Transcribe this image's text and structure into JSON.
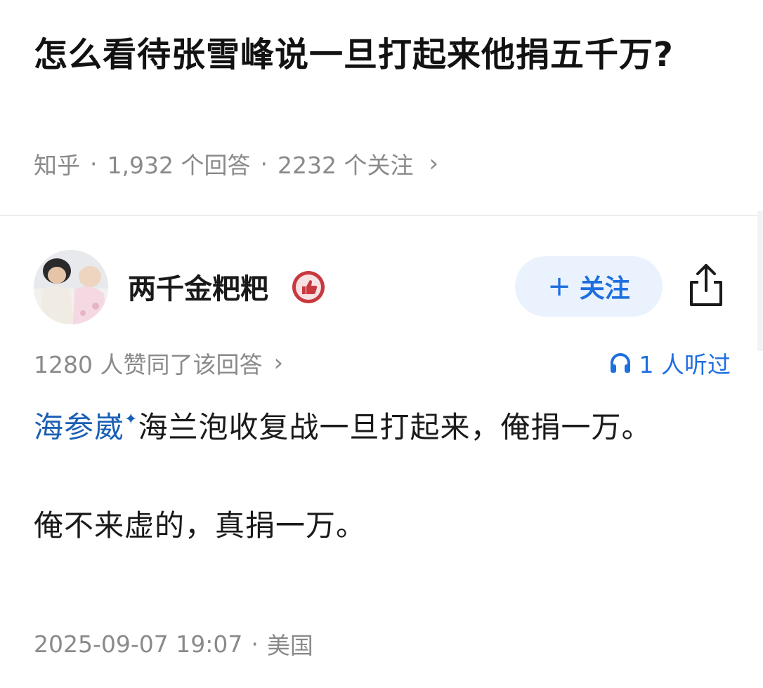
{
  "question": {
    "title": "怎么看待张雪峰说一旦打起来他捐五千万?",
    "source": "知乎",
    "answers_count": "1,932 个回答",
    "followers_count": "2232 个关注"
  },
  "author": {
    "name": "两千金粑粑",
    "follow_label": "关注"
  },
  "answer": {
    "likes_text": "1280 人赞同了该回答",
    "listened_text": "1 人听过",
    "topic_link": "海参崴",
    "paragraph1_rest": "海兰泡收复战一旦打起来，俺捐一万。",
    "paragraph2": "俺不来虚的，真捐一万。",
    "timestamp": "2025-09-07 19:07",
    "location": "美国"
  },
  "icons": {
    "badge": "thumbs-up-badge-icon",
    "share": "share-icon",
    "headphones": "headphones-icon",
    "chevron": "chevron-right-icon"
  },
  "colors": {
    "accent": "#1e6fe0",
    "link": "#1a5fb4",
    "meta_gray": "#8a8a8a",
    "follow_bg": "#eaf2fd",
    "badge_red": "#c8383f"
  }
}
